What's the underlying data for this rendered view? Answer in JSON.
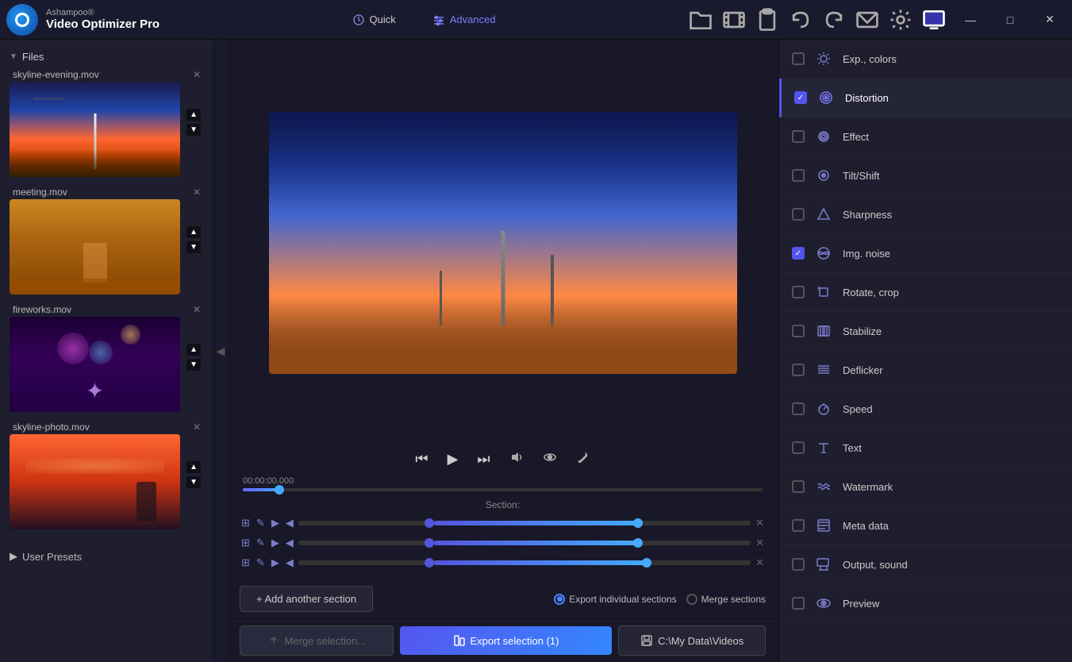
{
  "app": {
    "brand": "Ashampoo®",
    "name": "Video Optimizer Pro"
  },
  "titlebar": {
    "quick_label": "Quick",
    "advanced_label": "Advanced",
    "icons": [
      "folder-open",
      "film-strip",
      "clipboard",
      "undo-icon",
      "redo-icon",
      "email-icon",
      "settings-icon",
      "monitor-icon"
    ]
  },
  "window_controls": {
    "minimize": "—",
    "maximize": "□",
    "close": "✕"
  },
  "sidebar": {
    "files_label": "Files",
    "user_presets_label": "User Presets",
    "files": [
      {
        "name": "skyline-evening.mov",
        "thumb_type": "sky"
      },
      {
        "name": "meeting.mov",
        "thumb_type": "meeting"
      },
      {
        "name": "fireworks.mov",
        "thumb_type": "fireworks"
      },
      {
        "name": "skyline-photo.mov",
        "thumb_type": "sunset"
      }
    ]
  },
  "video": {
    "timestamp": "00:00:00.000",
    "section_label": "Section:"
  },
  "sections": [
    {
      "id": 1,
      "fill_left": "30%",
      "fill_width": "45%",
      "left_thumb": "28%",
      "right_thumb": "74%"
    },
    {
      "id": 2,
      "fill_left": "30%",
      "fill_width": "45%",
      "left_thumb": "28%",
      "right_thumb": "74%"
    },
    {
      "id": 3,
      "fill_left": "30%",
      "fill_width": "45%",
      "left_thumb": "28%",
      "right_thumb": "74%"
    }
  ],
  "bottom": {
    "add_section_label": "+ Add another section",
    "export_individual_label": "Export individual sections",
    "merge_sections_label": "Merge sections"
  },
  "actions": {
    "merge_label": "Merge selection...",
    "export_label": "Export selection (1)",
    "path_label": "C:\\My Data\\Videos"
  },
  "panel": {
    "items": [
      {
        "id": "exp-colors",
        "label": "Exp., colors",
        "checked": false,
        "active": false,
        "icon": "sun"
      },
      {
        "id": "distortion",
        "label": "Distortion",
        "checked": true,
        "active": true,
        "icon": "circle-grid"
      },
      {
        "id": "effect",
        "label": "Effect",
        "checked": false,
        "active": false,
        "icon": "sparkle"
      },
      {
        "id": "tilt-shift",
        "label": "Tilt/Shift",
        "checked": false,
        "active": false,
        "icon": "target"
      },
      {
        "id": "sharpness",
        "label": "Sharpness",
        "checked": false,
        "active": false,
        "icon": "triangle"
      },
      {
        "id": "img-noise",
        "label": "Img. noise",
        "checked": true,
        "active": false,
        "icon": "globe"
      },
      {
        "id": "rotate-crop",
        "label": "Rotate, crop",
        "checked": false,
        "active": false,
        "icon": "crop"
      },
      {
        "id": "stabilize",
        "label": "Stabilize",
        "checked": false,
        "active": false,
        "icon": "stabilize"
      },
      {
        "id": "deflicker",
        "label": "Deflicker",
        "checked": false,
        "active": false,
        "icon": "grid"
      },
      {
        "id": "speed",
        "label": "Speed",
        "checked": false,
        "active": false,
        "icon": "gauge"
      },
      {
        "id": "text",
        "label": "Text",
        "checked": false,
        "active": false,
        "icon": "text-a"
      },
      {
        "id": "watermark",
        "label": "Watermark",
        "checked": false,
        "active": false,
        "icon": "waves"
      },
      {
        "id": "meta-data",
        "label": "Meta data",
        "checked": false,
        "active": false,
        "icon": "list"
      },
      {
        "id": "output-sound",
        "label": "Output, sound",
        "checked": false,
        "active": false,
        "icon": "output"
      },
      {
        "id": "preview",
        "label": "Preview",
        "checked": false,
        "active": false,
        "icon": "eye"
      }
    ]
  }
}
